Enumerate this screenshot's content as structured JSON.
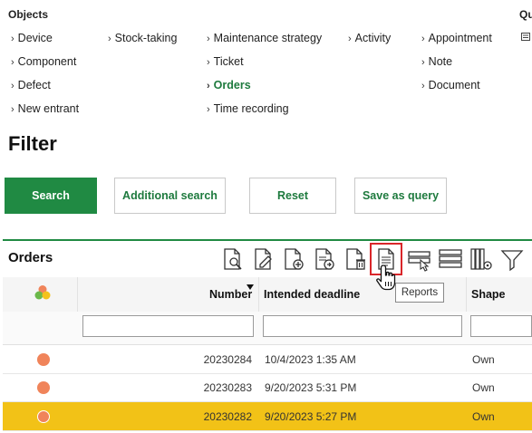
{
  "objects": {
    "title": "Objects",
    "col1": [
      "Device",
      "Component",
      "Defect",
      "New entrant"
    ],
    "col2": [
      "Stock-taking"
    ],
    "col3": [
      "Maintenance strategy",
      "Ticket",
      "Orders",
      "Time recording"
    ],
    "col4": [
      "Activity"
    ],
    "col5": [
      "Appointment",
      "Note",
      "Document"
    ],
    "active": "Orders"
  },
  "quick": {
    "title": "Qu"
  },
  "filter": {
    "title": "Filter",
    "search_label": "Search",
    "additional_label": "Additional search",
    "reset_label": "Reset",
    "save_label": "Save as query"
  },
  "orders": {
    "title": "Orders",
    "tooltip": "Reports",
    "toolbar_icons": [
      "search-document-icon",
      "edit-document-icon",
      "add-document-icon",
      "copy-document-icon",
      "delete-document-icon",
      "reports-icon",
      "select-rows-icon",
      "list-view-icon",
      "column-settings-icon",
      "filter-funnel-icon"
    ],
    "columns": {
      "number": "Number",
      "deadline": "Intended deadline",
      "shape": "Shape"
    },
    "rows": [
      {
        "number": "20230284",
        "deadline": "10/4/2023 1:35 AM",
        "shape": "Own",
        "selected": false
      },
      {
        "number": "20230283",
        "deadline": "9/20/2023 5:31 PM",
        "shape": "Own",
        "selected": false
      },
      {
        "number": "20230282",
        "deadline": "9/20/2023 5:27 PM",
        "shape": "Own",
        "selected": true
      }
    ]
  },
  "colors": {
    "accent": "#208a43",
    "selected_row": "#f2c217",
    "status_dot": "#f0845a",
    "highlight_box": "#d9262a"
  }
}
